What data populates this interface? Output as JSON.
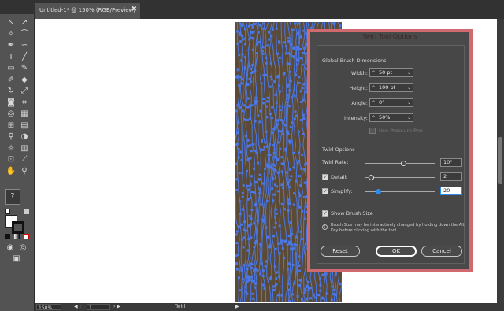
{
  "document_tab": {
    "title": "Untitled-1* @ 150% (RGB/Preview)",
    "close_glyph": "✖"
  },
  "tools": [
    {
      "name": "selection-tool-icon",
      "glyph": "↖"
    },
    {
      "name": "direct-selection-tool-icon",
      "glyph": "↗"
    },
    {
      "name": "magic-wand-tool-icon",
      "glyph": "✧"
    },
    {
      "name": "lasso-tool-icon",
      "glyph": "⌒"
    },
    {
      "name": "pen-tool-icon",
      "glyph": "✒"
    },
    {
      "name": "curvature-tool-icon",
      "glyph": "∽"
    },
    {
      "name": "type-tool-icon",
      "glyph": "T"
    },
    {
      "name": "line-tool-icon",
      "glyph": "╱"
    },
    {
      "name": "rectangle-tool-icon",
      "glyph": "▭"
    },
    {
      "name": "paintbrush-tool-icon",
      "glyph": "✎"
    },
    {
      "name": "shaper-tool-icon",
      "glyph": "✐"
    },
    {
      "name": "eraser-tool-icon",
      "glyph": "◆"
    },
    {
      "name": "rotate-tool-icon",
      "glyph": "↻"
    },
    {
      "name": "scale-tool-icon",
      "glyph": "⤢"
    },
    {
      "name": "twirl-tool-icon",
      "glyph": "◙"
    },
    {
      "name": "free-transform-tool-icon",
      "glyph": "⌗"
    },
    {
      "name": "shape-builder-tool-icon",
      "glyph": "◎"
    },
    {
      "name": "perspective-grid-tool-icon",
      "glyph": "▦"
    },
    {
      "name": "mesh-tool-icon",
      "glyph": "⊞"
    },
    {
      "name": "gradient-tool-icon",
      "glyph": "▤"
    },
    {
      "name": "eyedropper-tool-icon",
      "glyph": "⚲"
    },
    {
      "name": "blend-tool-icon",
      "glyph": "◑"
    },
    {
      "name": "symbol-sprayer-tool-icon",
      "glyph": "☼"
    },
    {
      "name": "column-graph-tool-icon",
      "glyph": "▥"
    },
    {
      "name": "artboard-tool-icon",
      "glyph": "⊡"
    },
    {
      "name": "slice-tool-icon",
      "glyph": "⟋"
    },
    {
      "name": "hand-tool-icon",
      "glyph": "✋"
    },
    {
      "name": "zoom-tool-icon",
      "glyph": "⚲"
    }
  ],
  "help_glyph": "?",
  "colors": {
    "panel": "#535353",
    "canvas": "#ffffff",
    "artwork_brown": "#5a4a36",
    "path_blue": "#4a78e8",
    "dialog_border": "#d06a6f",
    "dialog_bg": "#4a4a4a",
    "slider_active": "#2d8ceb"
  },
  "status_bar": {
    "zoom": "150%",
    "artboard": "1",
    "tool": "Twirl"
  },
  "dialog": {
    "title": "Twirl Tool Options",
    "global_section": "Global Brush Dimensions",
    "width_label": "Width:",
    "width_value": "50 pt",
    "height_label": "Height:",
    "height_value": "100 pt",
    "angle_label": "Angle:",
    "angle_value": "0°",
    "intensity_label": "Intensity:",
    "intensity_value": "50%",
    "use_pressure_pen": "Use Pressure Pen",
    "use_pressure_pen_checked": false,
    "twirl_section": "Twirl Options",
    "twirl_rate_label": "Twirl Rate:",
    "twirl_rate_value": "10°",
    "twirl_rate_level": 0.55,
    "detail_label": "Detail:",
    "detail_value": "2",
    "detail_checked": true,
    "detail_level": 0.1,
    "simplify_label": "Simplify:",
    "simplify_value": "20",
    "simplify_checked": true,
    "simplify_level": 0.2,
    "show_brush_size": "Show Brush Size",
    "show_brush_size_checked": true,
    "info_text": "Brush Size may be interactively changed by holding down the Alt Key before clicking with the tool.",
    "reset_label": "Reset",
    "ok_label": "OK",
    "cancel_label": "Cancel",
    "check_glyph": "✓",
    "spin_glyph": "⌃",
    "dropdown_glyph": "⌄",
    "info_glyph": "i"
  }
}
